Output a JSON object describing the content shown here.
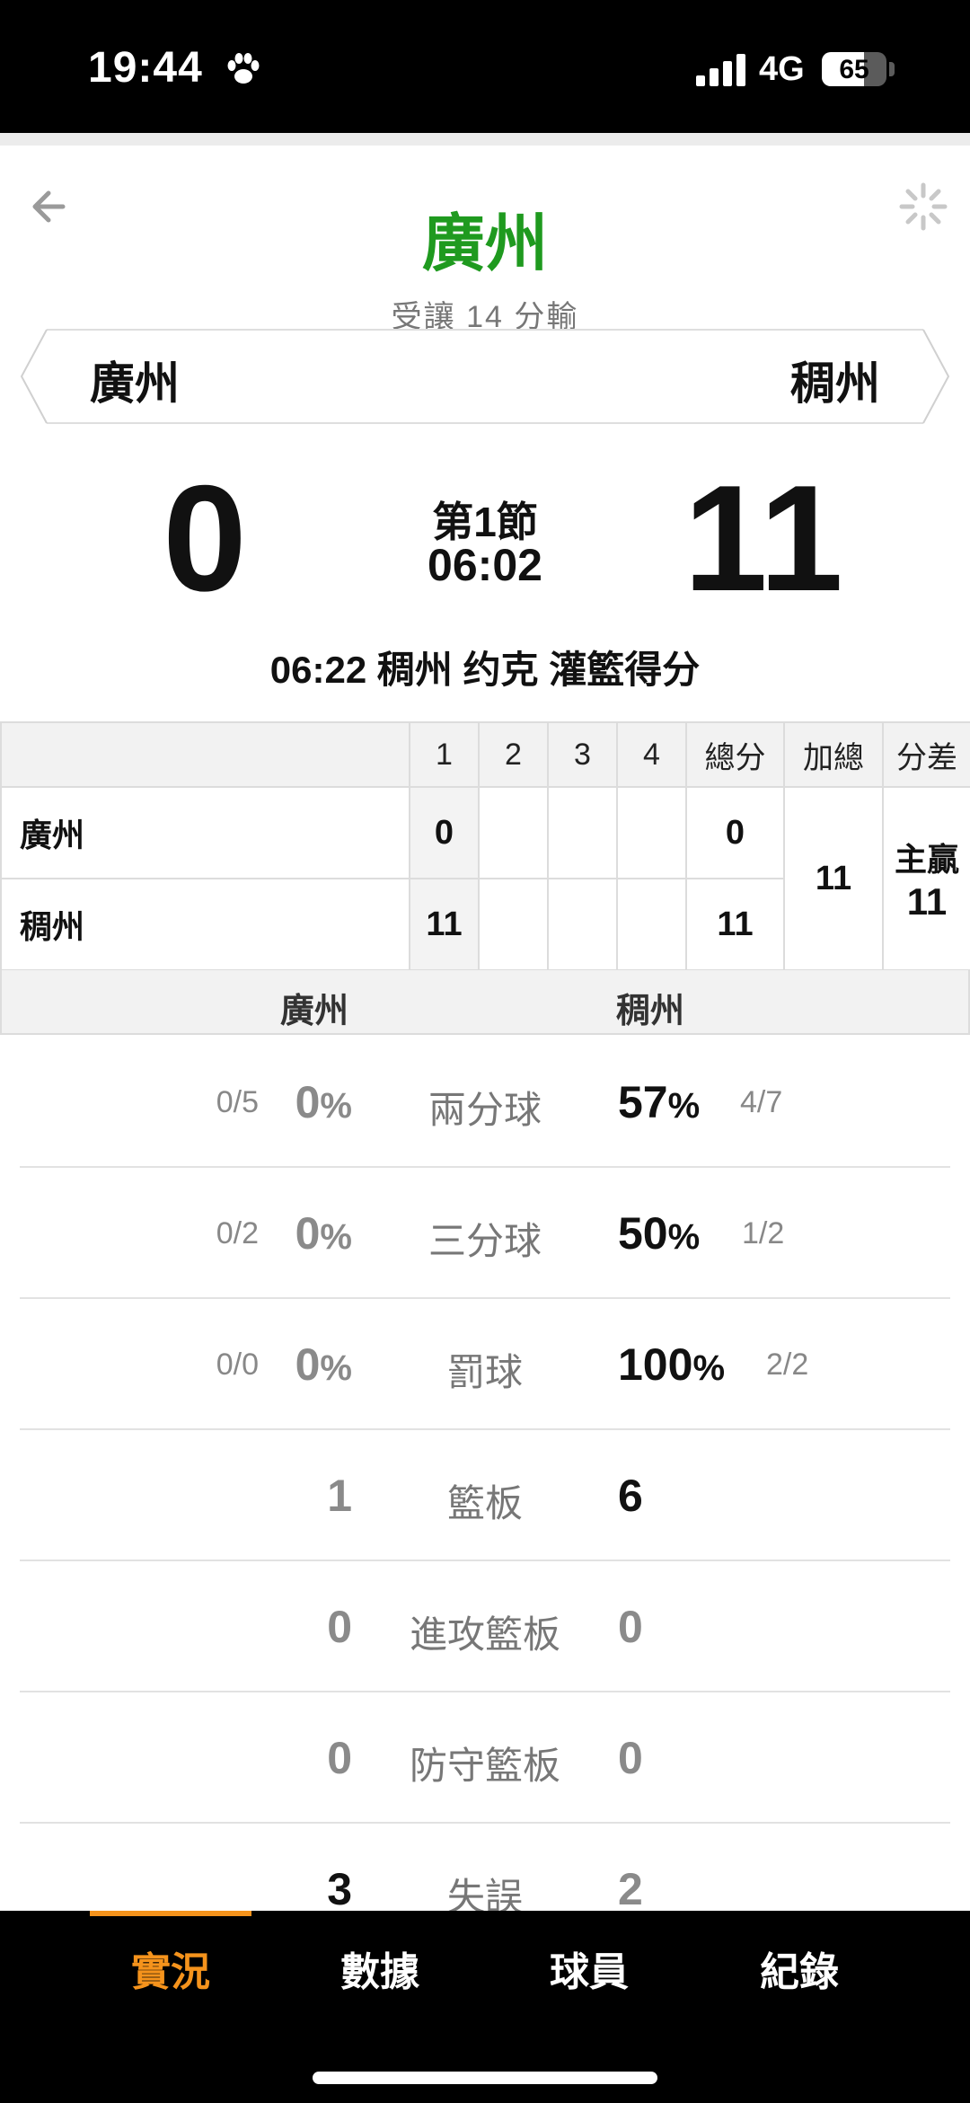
{
  "status_bar": {
    "time": "19:44",
    "network": "4G",
    "battery": "65",
    "battery_level": 0.65
  },
  "header": {
    "title": "廣州",
    "handicap_text": "受讓 14 分輸",
    "left_team": "廣州",
    "right_team": "稠州"
  },
  "scoreboard": {
    "left_score": "0",
    "right_score": "11",
    "period": "第1節",
    "clock": "06:02",
    "last_play": "06:22 稠州 约克 灌籃得分"
  },
  "box_score": {
    "headers": [
      "1",
      "2",
      "3",
      "4",
      "總分",
      "加總",
      "分差"
    ],
    "rows": [
      {
        "team": "廣州",
        "q1": "0",
        "q2": "",
        "q3": "",
        "q4": "",
        "total": "0"
      },
      {
        "team": "稠州",
        "q1": "11",
        "q2": "",
        "q3": "",
        "q4": "",
        "total": "11"
      }
    ],
    "combined_total": "11",
    "diff_label": "主贏",
    "diff_value": "11"
  },
  "stats": {
    "left_team": "廣州",
    "right_team": "稠州",
    "rows": [
      {
        "label": "兩分球",
        "left_fraction": "0/5",
        "left_value": "0",
        "left_pct": "%",
        "right_value": "57",
        "right_pct": "%",
        "right_fraction": "4/7"
      },
      {
        "label": "三分球",
        "left_fraction": "0/2",
        "left_value": "0",
        "left_pct": "%",
        "right_value": "50",
        "right_pct": "%",
        "right_fraction": "1/2"
      },
      {
        "label": "罰球",
        "left_fraction": "0/0",
        "left_value": "0",
        "left_pct": "%",
        "right_value": "100",
        "right_pct": "%",
        "right_fraction": "2/2"
      },
      {
        "label": "籃板",
        "left_value": "1",
        "right_value": "6"
      },
      {
        "label": "進攻籃板",
        "left_value": "0",
        "right_value": "0"
      },
      {
        "label": "防守籃板",
        "left_value": "0",
        "right_value": "0"
      },
      {
        "label": "失誤",
        "left_value": "3",
        "right_value": "2"
      }
    ]
  },
  "bottom_nav": {
    "tabs": [
      {
        "label": "實況",
        "active": true
      },
      {
        "label": "數據",
        "active": false
      },
      {
        "label": "球員",
        "active": false
      },
      {
        "label": "紀錄",
        "active": false
      }
    ]
  },
  "colors": {
    "title_green": "#1f9a1f",
    "accent_orange": "#f5931c"
  }
}
